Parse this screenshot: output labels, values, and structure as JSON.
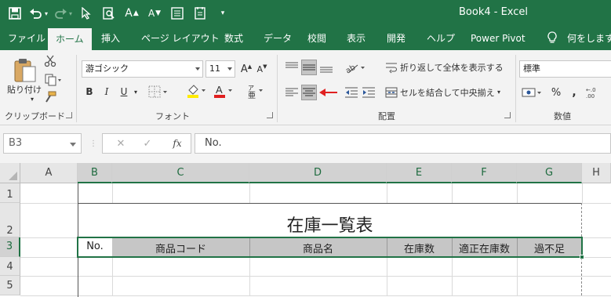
{
  "window": {
    "title": "Book4  -  Excel"
  },
  "qat": {
    "save_icon": "save-icon",
    "undo_icon": "undo-icon",
    "redo_icon": "redo-icon",
    "pointer_icon": "pointer-icon",
    "preview_icon": "print-preview-icon",
    "font_up_label": "A",
    "font_down_label": "A",
    "form_icon": "form-icon",
    "checklist_icon": "checklist-icon",
    "customize_icon": "customize-icon"
  },
  "tabs": [
    {
      "label": "ファイル"
    },
    {
      "label": "ホーム"
    },
    {
      "label": "挿入"
    },
    {
      "label": "ページ レイアウト"
    },
    {
      "label": "数式"
    },
    {
      "label": "データ"
    },
    {
      "label": "校閲"
    },
    {
      "label": "表示"
    },
    {
      "label": "開発"
    },
    {
      "label": "ヘルプ"
    },
    {
      "label": "Power Pivot"
    }
  ],
  "tellme": {
    "label": "何をしますか"
  },
  "ribbon": {
    "clipboard": {
      "paste_label": "貼り付け",
      "group_label": "クリップボード"
    },
    "font": {
      "font_name": "游ゴシック",
      "font_size": "11",
      "bold": "B",
      "italic": "I",
      "underline": "U",
      "font_color_label": "A",
      "group_label": "フォント"
    },
    "alignment": {
      "wrap_label": "折り返して全体を表示する",
      "merge_label": "セルを結合して中央揃え",
      "group_label": "配置",
      "arrow_color": "#e02020"
    },
    "number": {
      "format": "標準",
      "percent": "%",
      "comma": ",",
      "group_label": "数値"
    }
  },
  "formula_bar": {
    "name_box": "B3",
    "cancel": "✕",
    "enter": "✓",
    "fx": "fx",
    "value": "No."
  },
  "sheet": {
    "columns": [
      "A",
      "B",
      "C",
      "D",
      "E",
      "F",
      "G",
      "H"
    ],
    "rows": [
      "1",
      "2",
      "3",
      "4",
      "5"
    ],
    "title": "在庫一覧表",
    "headers": [
      "No.",
      "商品コード",
      "商品名",
      "在庫数",
      "適正在庫数",
      "過不足"
    ],
    "selection_color": "#217346",
    "header_fill": "#c6c6c6"
  },
  "colors": {
    "brand": "#217346",
    "ribbon_bg": "#f3f3f3"
  }
}
